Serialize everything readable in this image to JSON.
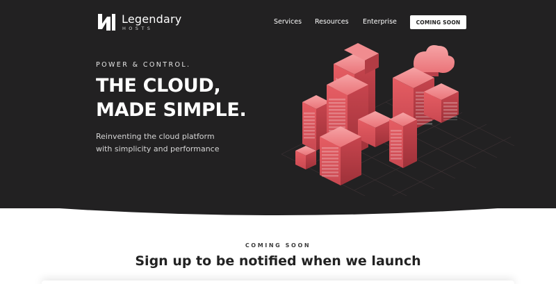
{
  "brand": {
    "name": "Legendary",
    "sub": "HOSTS",
    "logo_icon": "legendary-hosts-logo-mark"
  },
  "nav": {
    "items": [
      {
        "label": "Services"
      },
      {
        "label": "Resources"
      },
      {
        "label": "Enterprise"
      }
    ],
    "cta_label": "COMING SOON"
  },
  "hero": {
    "tagline": "POWER & CONTROL.",
    "headline_line1": "THE CLOUD,",
    "headline_line2": "MADE SIMPLE.",
    "subtext_line1": "Reinventing the cloud platform",
    "subtext_line2": "with simplicity and performance",
    "illustration_icon": "isometric-cloud-servers-illustration"
  },
  "signup": {
    "label": "COMING SOON",
    "title": "Sign up to be notified when we launch"
  },
  "colors": {
    "hero_background": "#222122",
    "accent": "#e0565d",
    "accent_dark": "#b23c44",
    "accent_light": "#f08c8f",
    "page_background": "#ffffff"
  }
}
